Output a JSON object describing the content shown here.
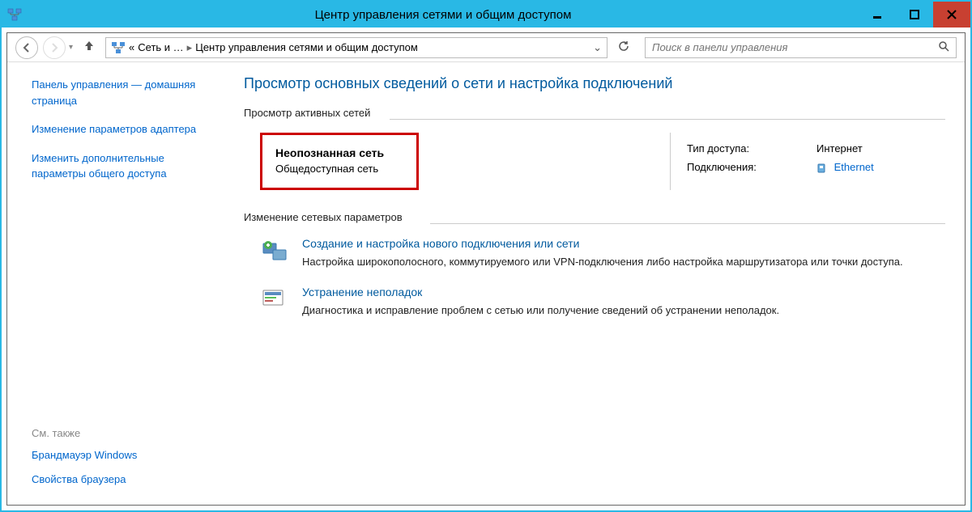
{
  "window": {
    "title": "Центр управления сетями и общим доступом"
  },
  "breadcrumb": {
    "prefix": "«",
    "part1": "Сеть и …",
    "part2": "Центр управления сетями и общим доступом"
  },
  "search": {
    "placeholder": "Поиск в панели управления"
  },
  "sidebar": {
    "links": [
      "Панель управления — домашняя страница",
      "Изменение параметров адаптера",
      "Изменить дополнительные параметры общего доступа"
    ],
    "see_also_heading": "См. также",
    "see_also": [
      "Брандмауэр Windows",
      "Свойства браузера"
    ]
  },
  "main": {
    "heading": "Просмотр основных сведений о сети и настройка подключений",
    "section1": "Просмотр активных сетей",
    "network": {
      "name": "Неопознанная сеть",
      "type": "Общедоступная сеть",
      "access_label": "Тип доступа:",
      "access_value": "Интернет",
      "conn_label": "Подключения:",
      "conn_value": "Ethernet"
    },
    "section2": "Изменение сетевых параметров",
    "options": [
      {
        "title": "Создание и настройка нового подключения или сети",
        "desc": "Настройка широкополосного, коммутируемого или VPN-подключения либо настройка маршрутизатора или точки доступа."
      },
      {
        "title": "Устранение неполадок",
        "desc": "Диагностика и исправление проблем с сетью или получение сведений об устранении неполадок."
      }
    ]
  }
}
